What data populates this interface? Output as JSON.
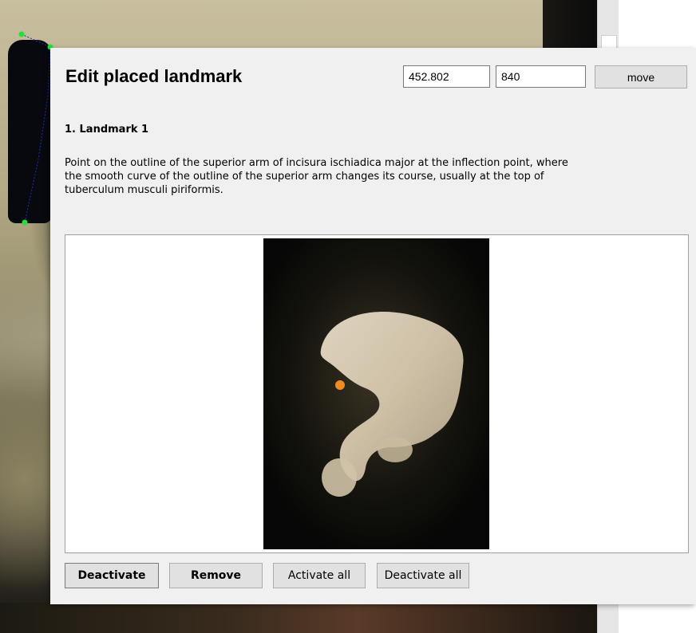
{
  "dialog": {
    "title": "Edit placed landmark",
    "coord_x": "452.802",
    "coord_y": "840",
    "move_label": "move",
    "landmark_heading": "1. Landmark 1",
    "landmark_description": "Point on the outline of the superior arm of incisura ischiadica major at the inflection point, where the smooth curve of the outline of the superior arm changes its course, usually at the top of tuberculum musculi piriformis.",
    "buttons": {
      "deactivate": "Deactivate",
      "remove": "Remove",
      "activate_all": "Activate all",
      "deactivate_all": "Deactivate all"
    }
  },
  "colors": {
    "landmark_marker": "#f08a24",
    "canvas_points": "#22e03a",
    "outline_line": "#1b2fb0"
  }
}
